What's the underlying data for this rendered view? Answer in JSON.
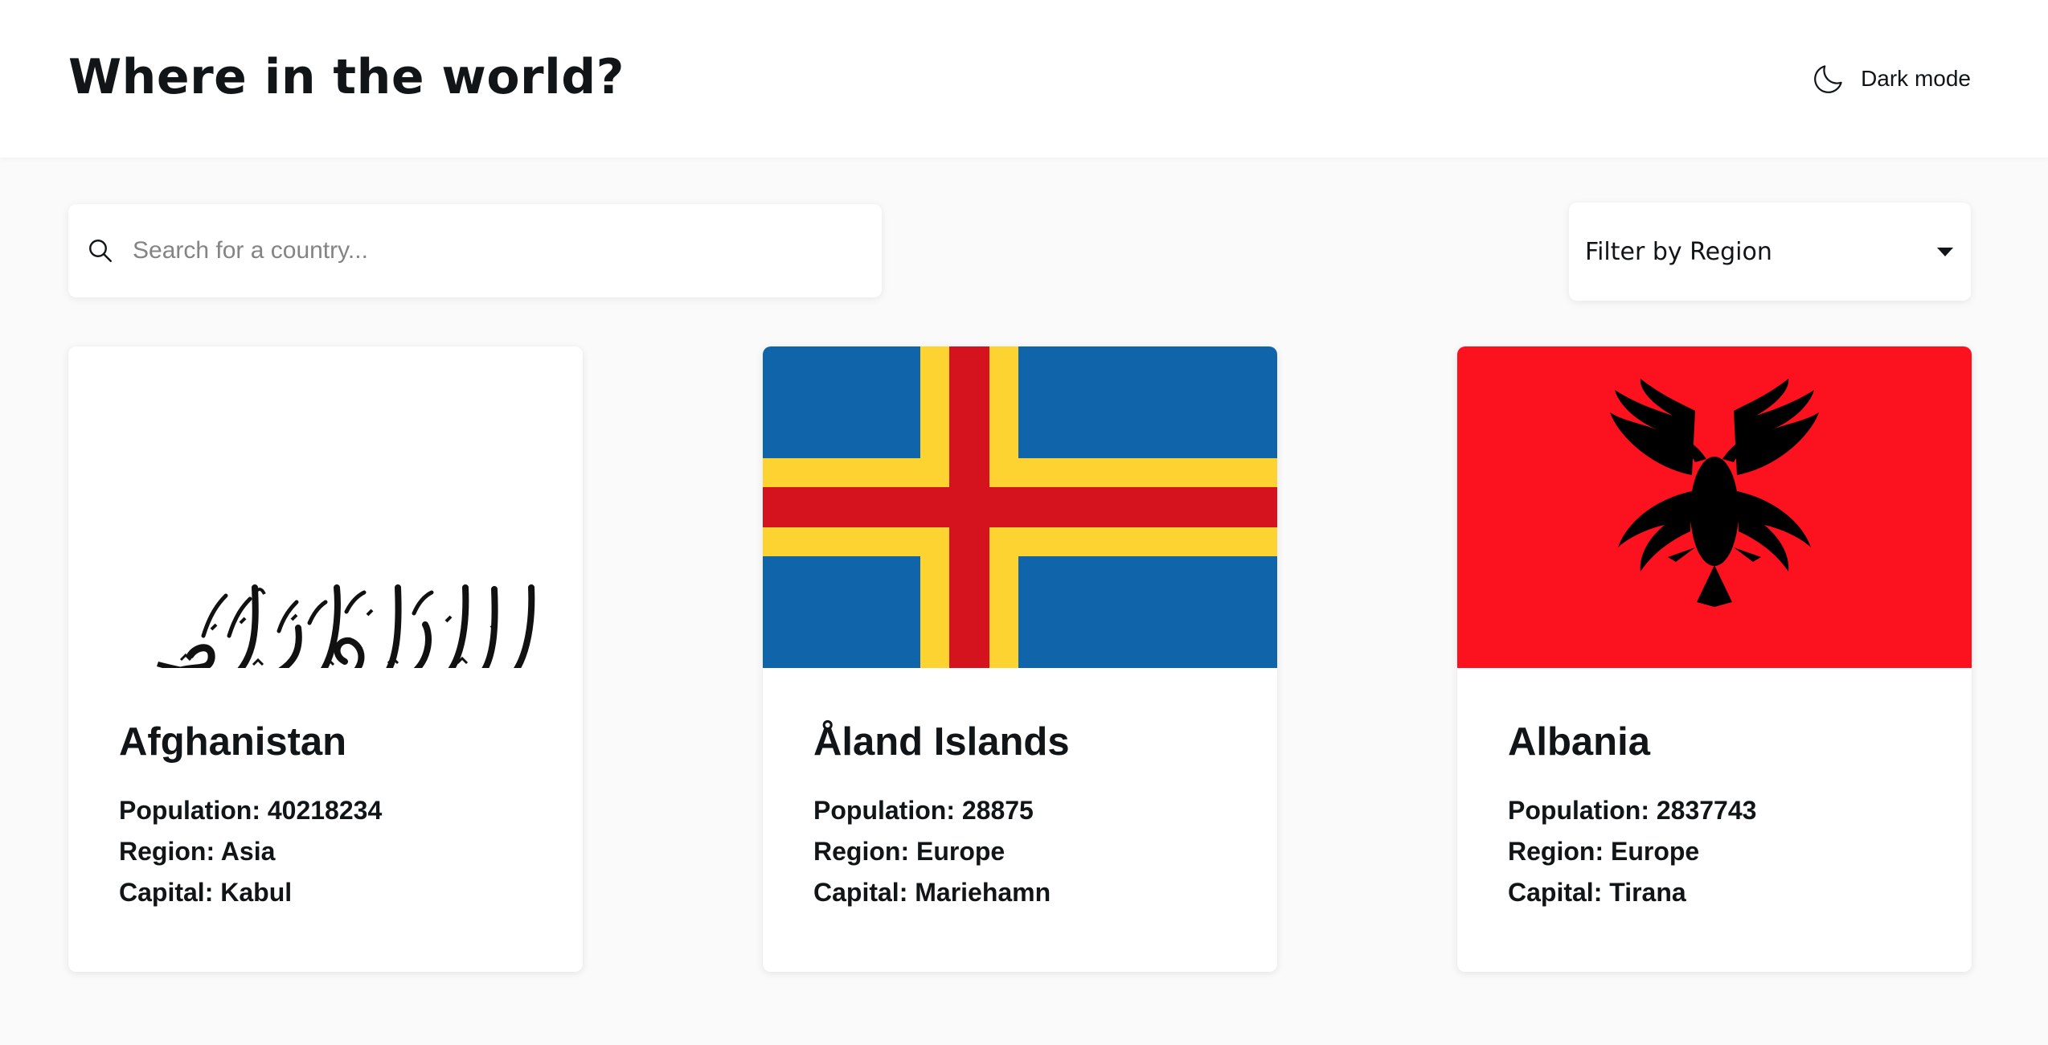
{
  "header": {
    "title": "Where in the world?",
    "theme_toggle_label": "Dark mode",
    "theme_icon": "moon-icon"
  },
  "search": {
    "placeholder": "Search for a country...",
    "value": "",
    "icon": "search-icon"
  },
  "filter": {
    "label": "Filter by Region",
    "icon": "caret-down-icon"
  },
  "countries": [
    {
      "name": "Afghanistan",
      "population_label": "Population:",
      "population": "40218234",
      "region_label": "Region:",
      "region": "Asia",
      "capital_label": "Capital:",
      "capital": "Kabul",
      "flag": "afghanistan-flag"
    },
    {
      "name": "Åland Islands",
      "population_label": "Population:",
      "population": "28875",
      "region_label": "Region:",
      "region": "Europe",
      "capital_label": "Capital:",
      "capital": "Mariehamn",
      "flag": "aland-islands-flag"
    },
    {
      "name": "Albania",
      "population_label": "Population:",
      "population": "2837743",
      "region_label": "Region:",
      "region": "Europe",
      "capital_label": "Capital:",
      "capital": "Tirana",
      "flag": "albania-flag"
    }
  ],
  "colors": {
    "background": "#fafafa",
    "surface": "#ffffff",
    "text": "#111517",
    "placeholder": "#848484",
    "aland_blue": "#0f64aa",
    "aland_yellow": "#fdd331",
    "aland_red": "#d5131f",
    "albania_red": "#fc111e"
  }
}
